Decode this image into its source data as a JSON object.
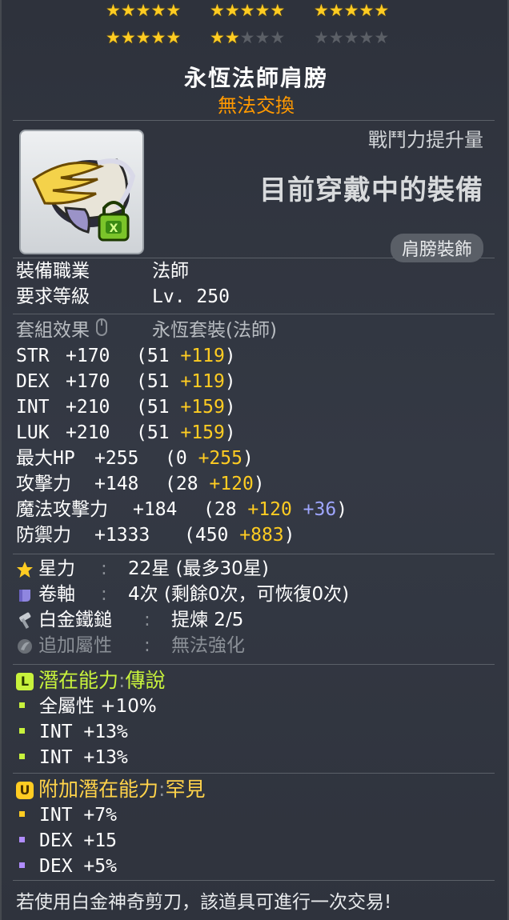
{
  "stars": {
    "total": 30,
    "filled": 22,
    "star_glyph": "★"
  },
  "item": {
    "name": "永恆法師肩膀",
    "trade_status": "無法交換",
    "combat_power_label": "戰鬥力提升量",
    "equipped_notice": "目前穿戴中的裝備",
    "slot_badge": "肩膀裝飾"
  },
  "requirements": [
    {
      "label": "裝備職業",
      "value": "法師"
    },
    {
      "label": "要求等級",
      "value": "Lv. 250"
    }
  ],
  "set_effect": {
    "label": "套組效果",
    "value": "永恆套裝(法師)"
  },
  "stats": [
    {
      "name": "STR",
      "total": "+170",
      "base": "(51",
      "bonus": "+119",
      "extra": "",
      "close": ")"
    },
    {
      "name": "DEX",
      "total": "+170",
      "base": "(51",
      "bonus": "+119",
      "extra": "",
      "close": ")"
    },
    {
      "name": "INT",
      "total": "+210",
      "base": "(51",
      "bonus": "+159",
      "extra": "",
      "close": ")"
    },
    {
      "name": "LUK",
      "total": "+210",
      "base": "(51",
      "bonus": "+159",
      "extra": "",
      "close": ")"
    },
    {
      "name": "最大HP",
      "total": "+255",
      "base": "(0",
      "bonus": "+255",
      "extra": "",
      "close": ")"
    },
    {
      "name": "攻擊力",
      "total": "+148",
      "base": "(28",
      "bonus": "+120",
      "extra": "",
      "close": ")"
    },
    {
      "name": "魔法攻擊力",
      "total": "+184",
      "base": "(28",
      "bonus": "+120",
      "extra": "+36",
      "close": ")"
    },
    {
      "name": "防禦力",
      "total": "+1333",
      "base": "(450",
      "bonus": "+883",
      "extra": "",
      "close": ")"
    }
  ],
  "enhance": {
    "starforce": {
      "label": "星力",
      "sep": ":",
      "value": "22星 (最多30星)"
    },
    "scroll": {
      "label": "卷軸",
      "sep": ":",
      "value": "4次 (剩餘0次，可恢復0次)"
    },
    "hammer": {
      "label": "白金鐵鎚",
      "sep": ":",
      "value": "提煉 2/5"
    },
    "flame": {
      "label": "追加屬性",
      "sep": ":",
      "value": "無法強化"
    }
  },
  "potential": {
    "badge": "L",
    "label": "潛在能力",
    "sep": ":",
    "tier": "傳說",
    "lines": [
      "全屬性 +10%",
      "INT +13%",
      "INT +13%"
    ]
  },
  "bonus_potential": {
    "badge": "U",
    "label": "附加潛在能力",
    "sep": ":",
    "tier": "罕見",
    "lines": [
      "INT +7%",
      "DEX +15",
      "DEX +5%"
    ]
  },
  "footer": "若使用白金神奇剪刀，該道具可進行一次交易!",
  "colors": {
    "accent_gold": "#ffcc22",
    "untradeable": "#ff9900",
    "legendary": "#c8f23c",
    "bonus_blue": "#9fa6ff",
    "rare_purple": "#b08cff"
  }
}
